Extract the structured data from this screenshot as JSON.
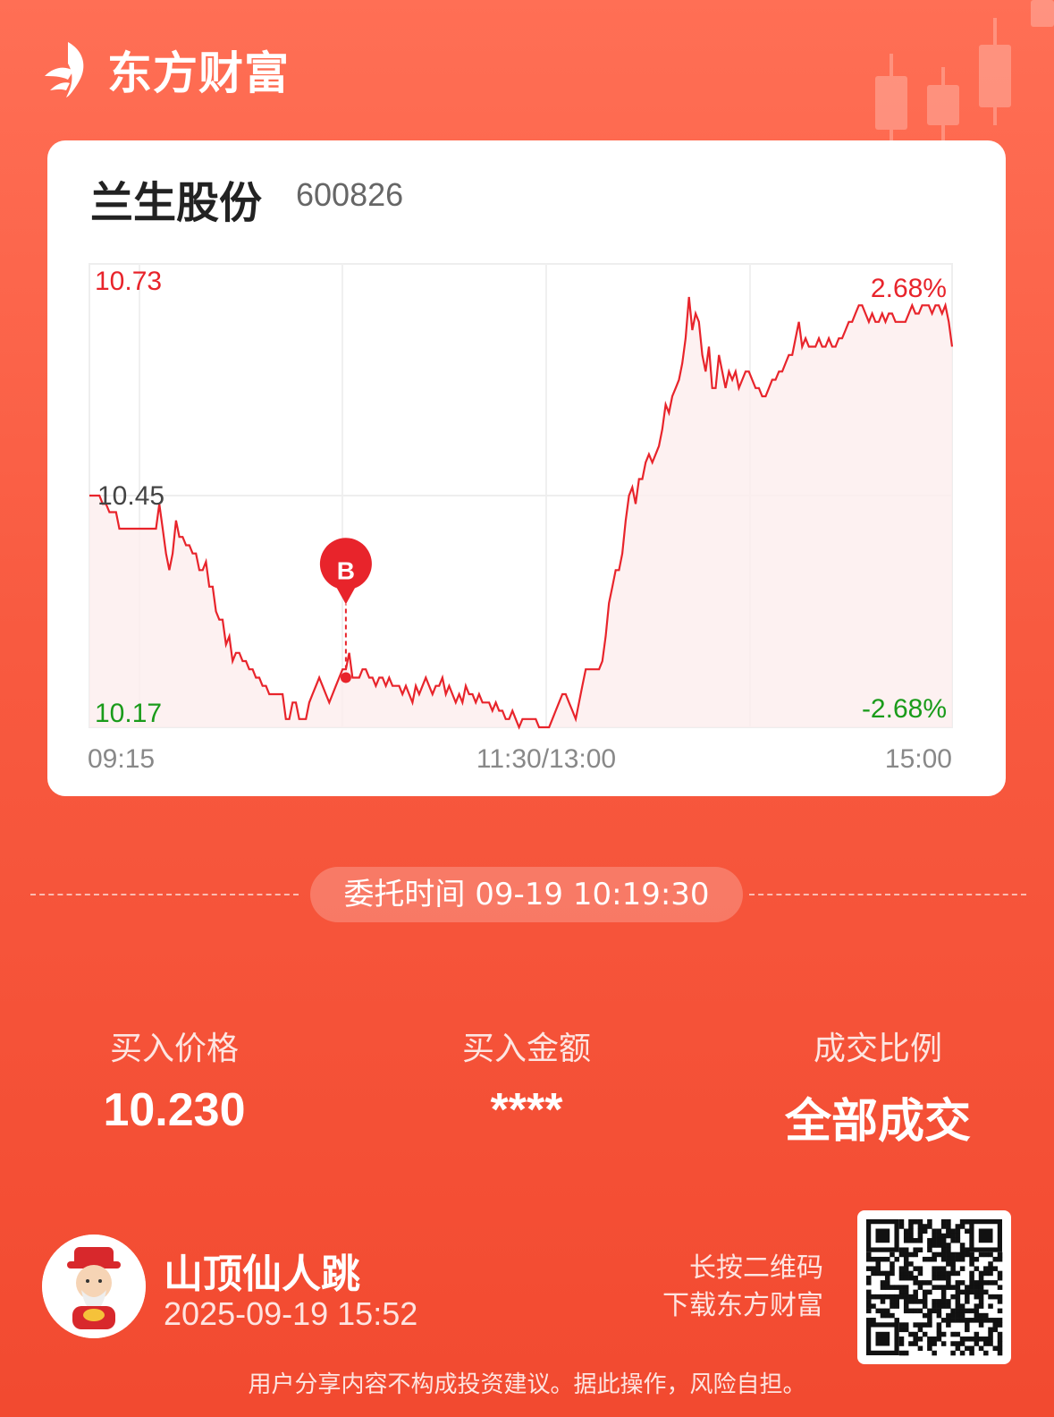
{
  "brand": {
    "name": "东方财富",
    "logo_icon": "eastmoney-logo-icon"
  },
  "stock": {
    "name": "兰生股份",
    "code": "600826"
  },
  "chart_data": {
    "type": "line",
    "x_ticks": [
      "09:15",
      "11:30/13:00",
      "15:00"
    ],
    "y_left_ticks": [
      "10.73",
      "10.45",
      "10.17"
    ],
    "y_right_ticks": [
      "2.68%",
      "-2.68%"
    ],
    "ylim": [
      10.17,
      10.73
    ],
    "grid": true,
    "series": [
      {
        "values": [
          10.45,
          10.45,
          10.45,
          10.45,
          10.44,
          10.44,
          10.43,
          10.43,
          10.43,
          10.41,
          10.41,
          10.41,
          10.41,
          10.41,
          10.41,
          10.41,
          10.41,
          10.41,
          10.41,
          10.41,
          10.41,
          10.44,
          10.41,
          10.38,
          10.36,
          10.38,
          10.42,
          10.4,
          10.4,
          10.39,
          10.39,
          10.38,
          10.38,
          10.36,
          10.36,
          10.37,
          10.34,
          10.34,
          10.31,
          10.3,
          10.3,
          10.27,
          10.28,
          10.25,
          10.26,
          10.26,
          10.25,
          10.25,
          10.24,
          10.24,
          10.23,
          10.23,
          10.22,
          10.22,
          10.21,
          10.21,
          10.21,
          10.21,
          10.21,
          10.18,
          10.18,
          10.2,
          10.2,
          10.18,
          10.18,
          10.18,
          10.2,
          10.21,
          10.22,
          10.23,
          10.22,
          10.21,
          10.2,
          10.21,
          10.22,
          10.23,
          10.24,
          10.24,
          10.26,
          10.23,
          10.23,
          10.23,
          10.24,
          10.24,
          10.23,
          10.23,
          10.22,
          10.23,
          10.23,
          10.22,
          10.23,
          10.22,
          10.22,
          10.22,
          10.21,
          10.22,
          10.21,
          10.2,
          10.22,
          10.21,
          10.22,
          10.23,
          10.22,
          10.21,
          10.22,
          10.22,
          10.23,
          10.21,
          10.22,
          10.21,
          10.2,
          10.21,
          10.2,
          10.22,
          10.21,
          10.21,
          10.2,
          10.21,
          10.2,
          10.2,
          10.2,
          10.19,
          10.2,
          10.19,
          10.19,
          10.18,
          10.18,
          10.19,
          10.18,
          10.17,
          10.18,
          10.18,
          10.18,
          10.18,
          10.18,
          10.17,
          10.17,
          10.17,
          10.17,
          10.18,
          10.19,
          10.2,
          10.21,
          10.21,
          10.2,
          10.19,
          10.18,
          10.2,
          10.22,
          10.24,
          10.24,
          10.24,
          10.24,
          10.24,
          10.25,
          10.28,
          10.32,
          10.34,
          10.36,
          10.36,
          10.38,
          10.42,
          10.45,
          10.46,
          10.44,
          10.47,
          10.47,
          10.49,
          10.5,
          10.49,
          10.5,
          10.51,
          10.53,
          10.56,
          10.55,
          10.57,
          10.58,
          10.59,
          10.61,
          10.64,
          10.69,
          10.65,
          10.67,
          10.66,
          10.62,
          10.6,
          10.63,
          10.58,
          10.58,
          10.62,
          10.6,
          10.58,
          10.6,
          10.59,
          10.6,
          10.58,
          10.59,
          10.6,
          10.6,
          10.59,
          10.58,
          10.58,
          10.57,
          10.57,
          10.58,
          10.59,
          10.59,
          10.6,
          10.6,
          10.61,
          10.62,
          10.62,
          10.64,
          10.66,
          10.63,
          10.64,
          10.63,
          10.63,
          10.63,
          10.64,
          10.63,
          10.63,
          10.64,
          10.63,
          10.63,
          10.64,
          10.64,
          10.65,
          10.66,
          10.66,
          10.67,
          10.68,
          10.68,
          10.67,
          10.66,
          10.67,
          10.66,
          10.66,
          10.67,
          10.66,
          10.67,
          10.67,
          10.66,
          10.66,
          10.66,
          10.66,
          10.67,
          10.68,
          10.67,
          10.67,
          10.68,
          10.68,
          10.68,
          10.67,
          10.68,
          10.68,
          10.67,
          10.68,
          10.66,
          10.63
        ]
      }
    ],
    "buy_marker": {
      "label": "B",
      "index": 77,
      "price": 10.23
    }
  },
  "order": {
    "time_text": "委托时间 09-19 10:19:30"
  },
  "stats": [
    {
      "label": "买入价格",
      "value": "10.230"
    },
    {
      "label": "买入金额",
      "value": "****"
    },
    {
      "label": "成交比例",
      "value": "全部成交"
    }
  ],
  "user": {
    "name": "山顶仙人跳",
    "time": "2025-09-19 15:52",
    "avatar_icon": "god-of-wealth-avatar-icon"
  },
  "qr": {
    "line1": "长按二维码",
    "line2": "下载东方财富",
    "icon": "qr-code-icon"
  },
  "disclaimer": "用户分享内容不构成投资建议。据此操作，风险自担。",
  "colors": {
    "up": "#e8242b",
    "down": "#1a9b1a",
    "neutral": "#444444",
    "accent": "#f85a40"
  }
}
